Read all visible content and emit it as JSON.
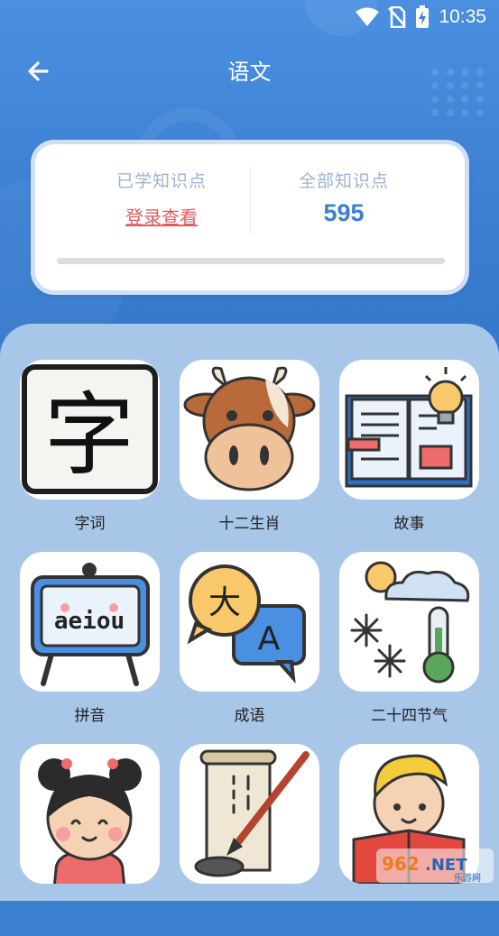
{
  "status_bar": {
    "time": "10:35"
  },
  "header": {
    "title": "语文"
  },
  "stats": {
    "learned_label": "已学知识点",
    "learned_action": "登录查看",
    "total_label": "全部知识点",
    "total_value": "595",
    "progress_fraction": 0
  },
  "categories": [
    {
      "label": "字词",
      "icon": "character-card-icon"
    },
    {
      "label": "十二生肖",
      "icon": "ox-zodiac-icon"
    },
    {
      "label": "故事",
      "icon": "open-book-lightbulb-icon"
    },
    {
      "label": "拼音",
      "icon": "pinyin-board-icon"
    },
    {
      "label": "成语",
      "icon": "translate-bubbles-icon"
    },
    {
      "label": "二十四节气",
      "icon": "weather-thermometer-icon"
    },
    {
      "label": "",
      "icon": "girl-face-icon"
    },
    {
      "label": "",
      "icon": "scroll-brush-icon"
    },
    {
      "label": "",
      "icon": "boy-reading-icon"
    }
  ],
  "watermark": {
    "text": "962.NET",
    "subtext": "乐游网"
  },
  "colors": {
    "header": "#3b7fd2",
    "panel": "#a8c6e8",
    "link": "#e35b5b",
    "number": "#3f7fcf"
  }
}
